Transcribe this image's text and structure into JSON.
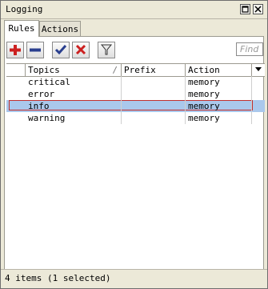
{
  "window": {
    "title": "Logging"
  },
  "tabs": [
    {
      "label": "Rules"
    },
    {
      "label": "Actions"
    }
  ],
  "toolbar": {
    "find_placeholder": "Find"
  },
  "table": {
    "columns": [
      "Topics",
      "Prefix",
      "Action"
    ],
    "rows": [
      {
        "topics": "critical",
        "prefix": "",
        "action": "memory"
      },
      {
        "topics": "error",
        "prefix": "",
        "action": "memory"
      },
      {
        "topics": "info",
        "prefix": "",
        "action": "memory",
        "selected": true
      },
      {
        "topics": "warning",
        "prefix": "",
        "action": "memory"
      }
    ]
  },
  "status": {
    "text": "4 items (1 selected)"
  },
  "colors": {
    "add": "#cc2020",
    "remove": "#2a3f8f",
    "enable": "#2a3f8f",
    "disable": "#cc2020",
    "selection": "#aac8ec"
  },
  "icons": [
    "plus-icon",
    "minus-icon",
    "checkmark-icon",
    "x-icon",
    "filter-icon",
    "sort-icon",
    "column-menu-icon",
    "restore-icon",
    "close-icon"
  ]
}
